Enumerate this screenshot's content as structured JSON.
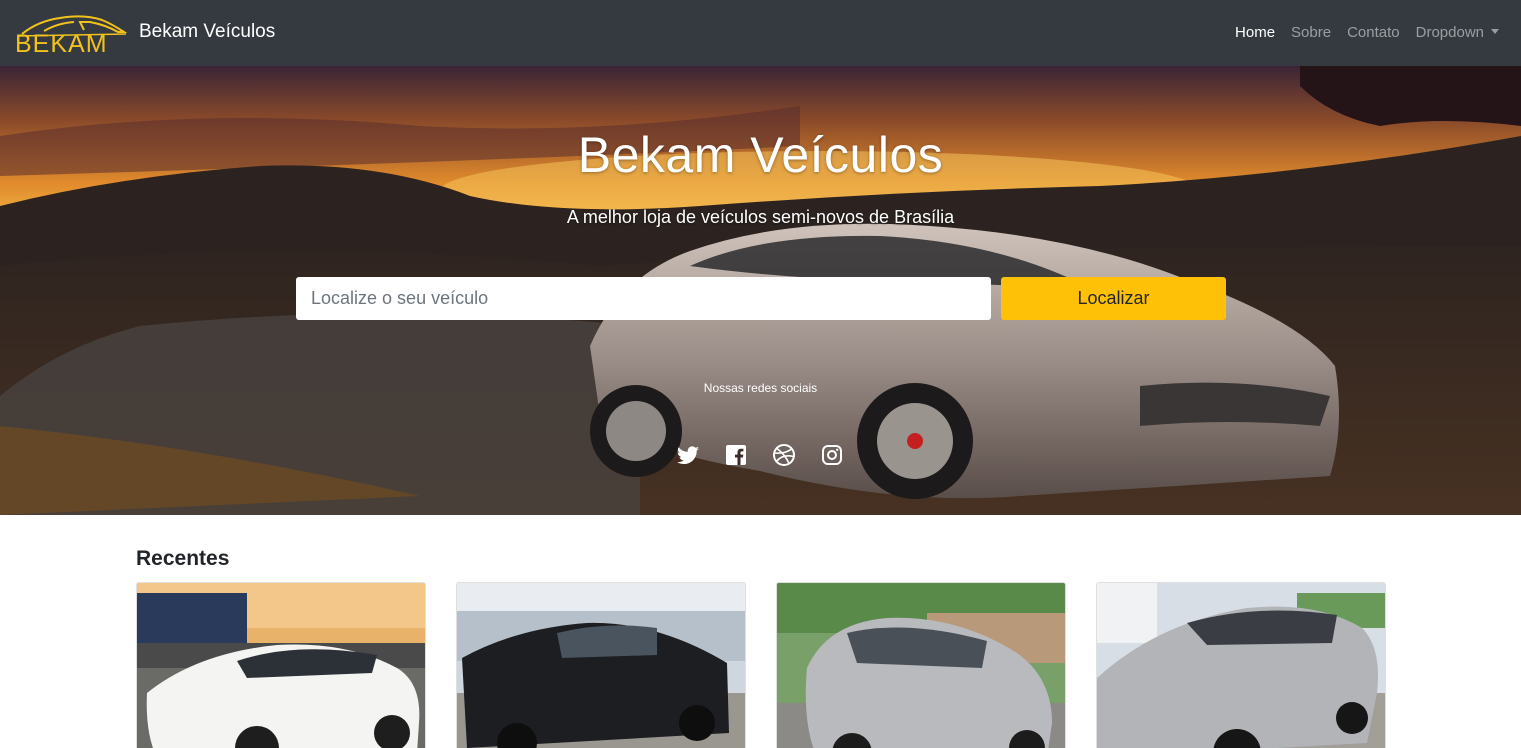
{
  "navbar": {
    "logo_text": "BEKAM",
    "brand_name": "Bekam Veículos",
    "links": [
      {
        "label": "Home",
        "active": true
      },
      {
        "label": "Sobre",
        "active": false
      },
      {
        "label": "Contato",
        "active": false
      },
      {
        "label": "Dropdown",
        "active": false
      }
    ]
  },
  "hero": {
    "title": "Bekam Veículos",
    "subtitle": "A melhor loja de veículos semi-novos de Brasília",
    "search_placeholder": "Localize o seu veículo",
    "search_button": "Localizar",
    "social_caption": "Nossas redes sociais",
    "social_icons": [
      "twitter-icon",
      "facebook-icon",
      "dribbble-icon",
      "instagram-icon"
    ]
  },
  "recentes": {
    "title": "Recentes",
    "cards": [
      "white-pickup-car-photo",
      "black-pickup-truck-photo",
      "silver-hatchback-photo",
      "silver-sedan-photo"
    ]
  },
  "colors": {
    "navbar_bg": "#343a40",
    "accent": "#ffc107",
    "logo": "#f2c21b"
  }
}
